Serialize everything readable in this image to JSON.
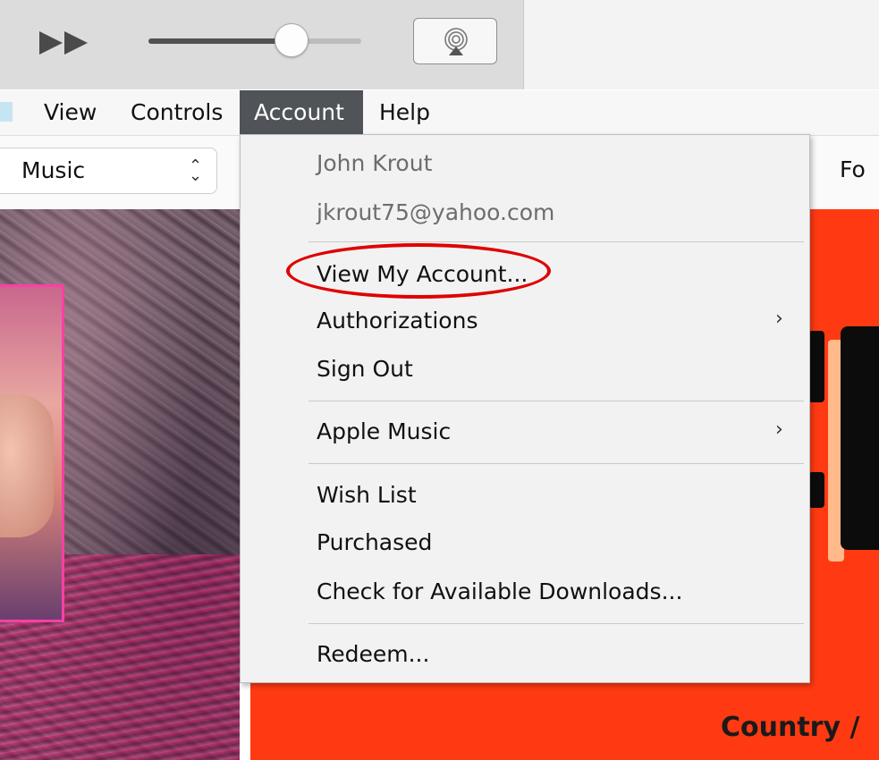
{
  "menubar": {
    "items": [
      {
        "label": "View"
      },
      {
        "label": "Controls"
      },
      {
        "label": "Account"
      },
      {
        "label": "Help"
      }
    ],
    "active": "Account"
  },
  "toolbar": {
    "volume_level": 0.67,
    "fast_forward_icon": "fast-forward-icon",
    "airplay_icon": "airplay-icon"
  },
  "library": {
    "media_type": "Music",
    "right_label": "Fo"
  },
  "account_menu": {
    "user_name": "John Krout",
    "user_email": "jkrout75@yahoo.com",
    "items": {
      "view_account": "View My Account...",
      "authorizations": "Authorizations",
      "sign_out": "Sign Out",
      "apple_music": "Apple Music",
      "wish_list": "Wish List",
      "purchased": "Purchased",
      "check_downloads": "Check for Available Downloads...",
      "redeem": "Redeem..."
    },
    "submenu_arrow": "›"
  },
  "content": {
    "right_banner_text": "Country /"
  },
  "colors": {
    "menu_active_bg": "#505358",
    "annotation": "#e00000",
    "banner_bg": "#ff3a12"
  }
}
